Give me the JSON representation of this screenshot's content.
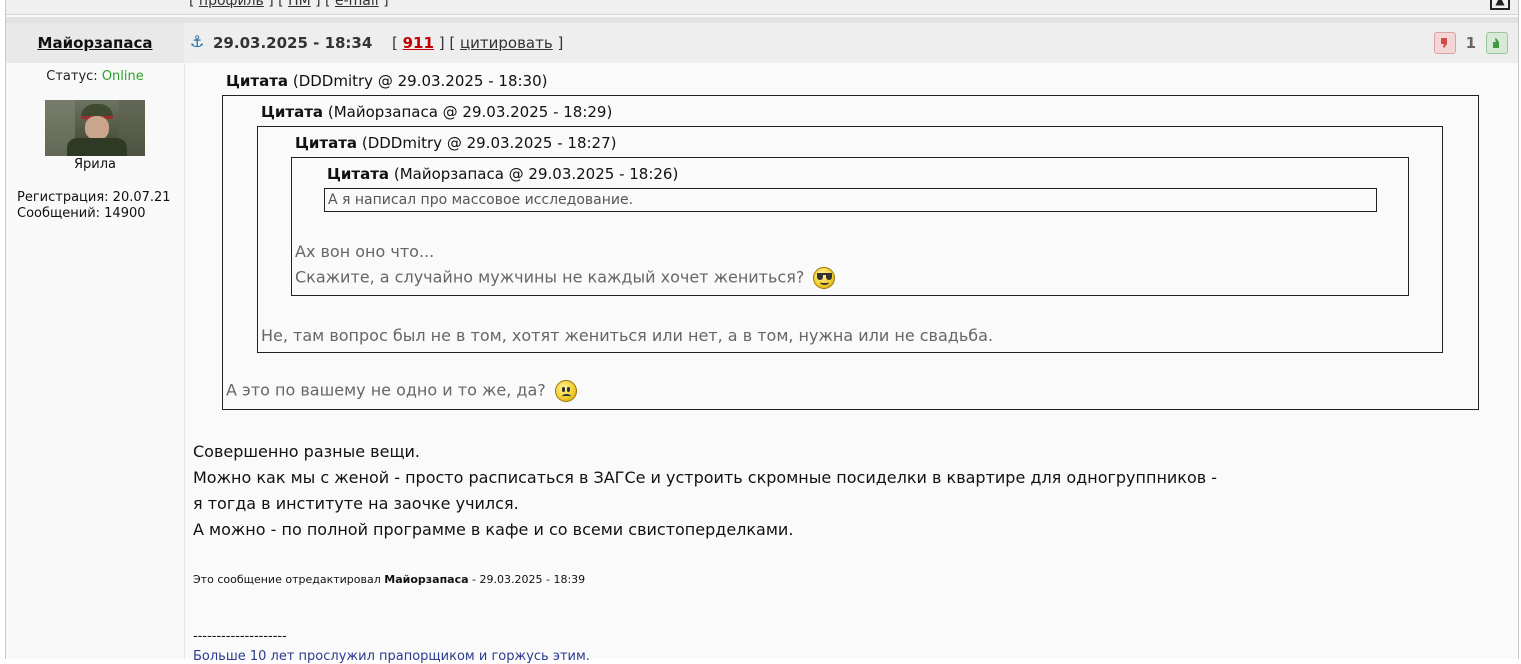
{
  "prev_post": {
    "links": [
      {
        "label": "профиль"
      },
      {
        "label": "ПМ"
      },
      {
        "label": "e-mail"
      }
    ],
    "up_icon": "arrow-up-icon"
  },
  "post": {
    "author": "Майорзапаса",
    "datetime": "29.03.2025 - 18:34",
    "post_number": "911",
    "quote_link": "цитировать",
    "rating": {
      "count": "1",
      "down_icon": "thumbs-down-icon",
      "up_icon": "thumbs-up-icon",
      "down_color": "#d04a4a",
      "up_color": "#3f9a3f"
    },
    "status_label": "Статус:",
    "status_value": "Online",
    "status_color": "#2aa12a",
    "user_title": "Ярила",
    "registration": "Регистрация: 20.07.21",
    "messages": "Сообщений: 14900"
  },
  "quotes": {
    "label": "Цитата",
    "q1_meta": "(DDDmitry @ 29.03.2025 - 18:30)",
    "q2_meta": "(Майорзапаса @ 29.03.2025 - 18:29)",
    "q3_meta": "(DDDmitry @ 29.03.2025 - 18:27)",
    "q4_meta": "(Майорзапаса @ 29.03.2025 - 18:26)",
    "q4_text": "А я написал про массовое исследование.",
    "q3_line1": "Ах вон оно что...",
    "q3_line2": "Скажите, а случайно мужчины не каждый хочет жениться?",
    "q2_text": "Не, там вопрос был не в том, хотят жениться или нет, а в том, нужна или не свадьба.",
    "q1_text": "А это по вашему не одно и то же, да?"
  },
  "message": {
    "lines": [
      "Совершенно разные вещи.",
      "Можно как мы с женой - просто расписаться в ЗАГСе и устроить скромные посиделки в квартире для одногруппников -",
      "я тогда в институте на заочке учился.",
      "А можно - по полной программе в кафе и со всеми свистоперделками."
    ],
    "edited_prefix": "Это сообщение отредактировал",
    "edited_author": "Майорзапаса",
    "edited_suffix": "- 29.03.2025 - 18:39"
  },
  "signature": {
    "separator": "--------------------",
    "text": "Больше 10 лет прослужил прапорщиком и горжусь этим."
  }
}
